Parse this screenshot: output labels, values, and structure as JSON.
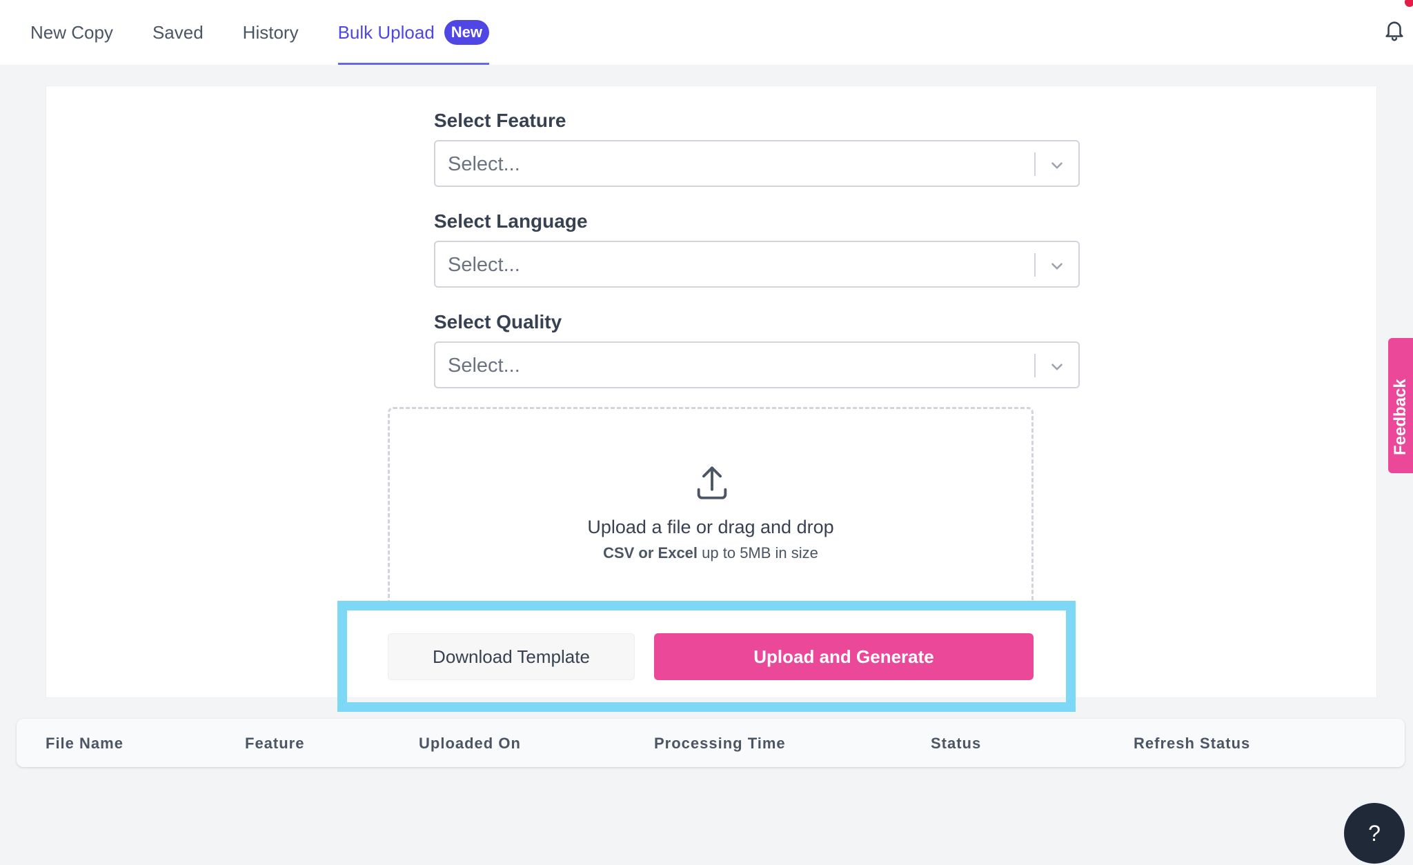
{
  "tabs": [
    {
      "label": "New Copy"
    },
    {
      "label": "Saved"
    },
    {
      "label": "History"
    },
    {
      "label": "Bulk Upload",
      "badge": "New",
      "active": true
    }
  ],
  "form": {
    "feature": {
      "label": "Select Feature",
      "placeholder": "Select..."
    },
    "language": {
      "label": "Select Language",
      "placeholder": "Select..."
    },
    "quality": {
      "label": "Select Quality",
      "placeholder": "Select..."
    }
  },
  "dropzone": {
    "title": "Upload a file or drag and drop",
    "formats": "CSV or Excel",
    "limit": "up to 5MB in size"
  },
  "buttons": {
    "download_template": "Download Template",
    "upload_generate": "Upload and Generate"
  },
  "table": {
    "columns": [
      "File Name",
      "Feature",
      "Uploaded On",
      "Processing Time",
      "Status",
      "Refresh Status"
    ]
  },
  "feedback_label": "Feedback",
  "help_label": "?",
  "colors": {
    "accent": "#4f46e5",
    "primary_button": "#ec4899",
    "highlight": "#7dd8f5"
  }
}
